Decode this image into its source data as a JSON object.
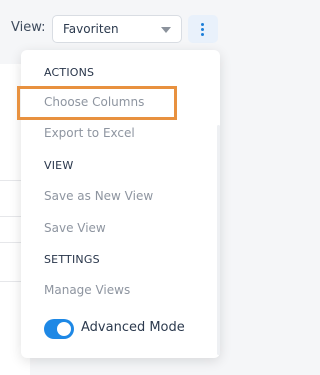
{
  "view_bar": {
    "label": "View:",
    "selected_view": "Favoriten",
    "caret_icon": "chevron-down-icon",
    "more_icon": "more-vertical-icon"
  },
  "menu": {
    "actions_header": "ACTIONS",
    "choose_columns": "Choose Columns",
    "export_to_excel": "Export to Excel",
    "view_header": "VIEW",
    "save_as_new_view": "Save as New View",
    "save_view": "Save View",
    "settings_header": "SETTINGS",
    "manage_views": "Manage Views",
    "advanced_mode_label": "Advanced Mode",
    "advanced_mode_on": true
  },
  "colors": {
    "accent": "#1e88e5",
    "highlight": "#e8913f"
  }
}
